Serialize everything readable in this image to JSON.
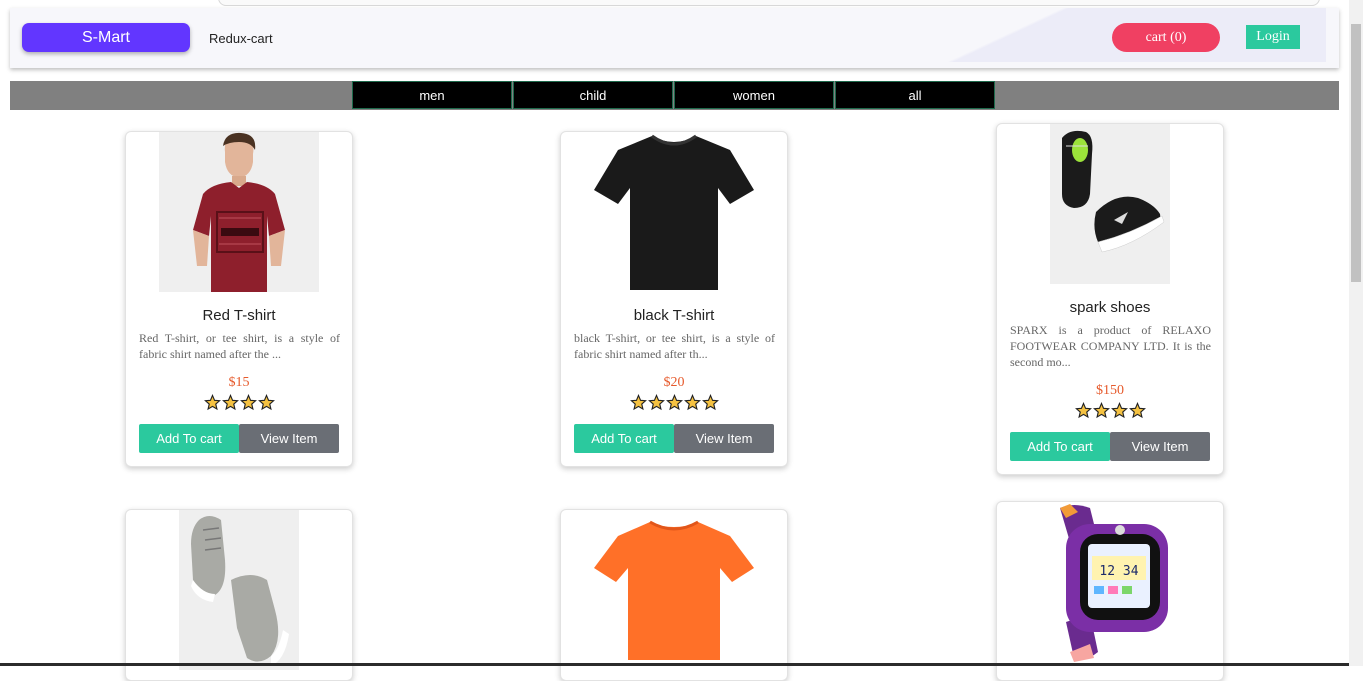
{
  "header": {
    "brand": "S-Mart",
    "subtitle": "Redux-cart",
    "cart_label": "cart (0)",
    "login_label": "Login"
  },
  "categories": [
    "men",
    "child",
    "women",
    "all"
  ],
  "products": [
    {
      "title": "Red T-shirt",
      "description": "Red T-shirt, or tee shirt, is a style of fabric shirt named after the ...",
      "price": "$15",
      "rating": 4,
      "add_label": "Add To cart",
      "view_label": "View Item",
      "image": "red-tshirt-model"
    },
    {
      "title": "black T-shirt",
      "description": "black T-shirt, or tee shirt, is a style of fabric shirt named after th...",
      "price": "$20",
      "rating": 5,
      "add_label": "Add To cart",
      "view_label": "View Item",
      "image": "black-tshirt"
    },
    {
      "title": "spark shoes",
      "description": "SPARX is a product of RELAXO FOOTWEAR COMPANY LTD. It is the second mo...",
      "price": "$150",
      "rating": 4,
      "add_label": "Add To cart",
      "view_label": "View Item",
      "image": "black-sneakers"
    },
    {
      "image": "grey-high-top-sneakers"
    },
    {
      "image": "orange-tshirt"
    },
    {
      "image": "purple-kids-smartwatch",
      "watch_time": "12 34"
    }
  ],
  "colors": {
    "brand": "#6236ff",
    "cart": "#f04062",
    "login": "#2bc99e",
    "price": "#e65a2c",
    "view_button": "#6a6e75",
    "star": "#f5c242"
  }
}
